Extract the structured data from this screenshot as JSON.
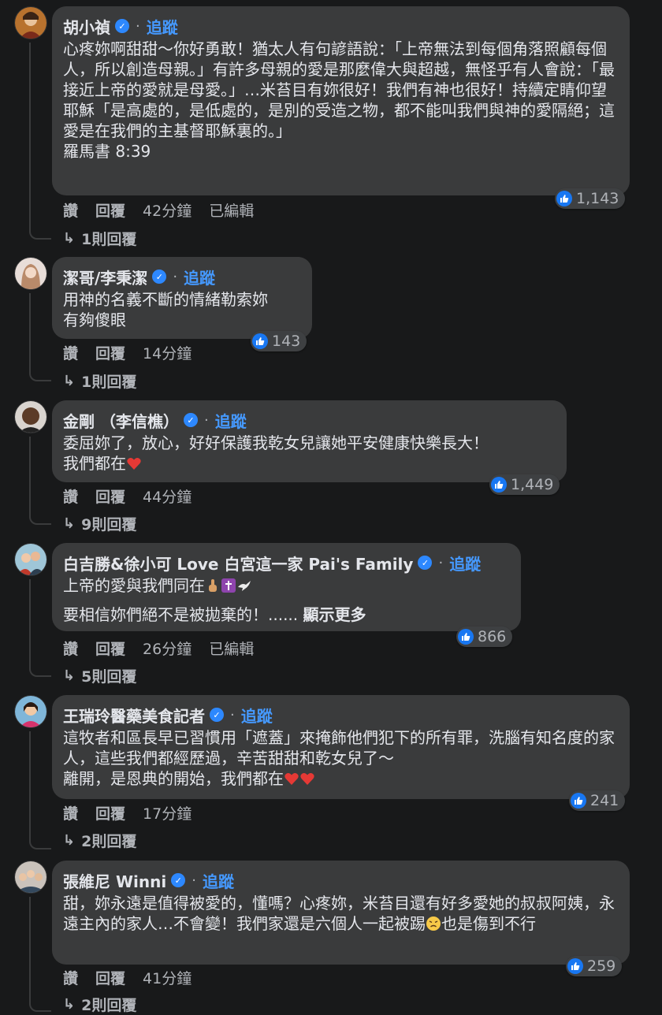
{
  "labels": {
    "follow": "追蹤",
    "like": "讚",
    "reply": "回覆",
    "dot": "·"
  },
  "colors": {
    "background": "#18191a",
    "bubble": "#3a3b3c",
    "accent": "#4599ff",
    "like": "#1877f2"
  },
  "comments": [
    {
      "author": "胡小禎",
      "verified": true,
      "paragraphs": [
        "心疼妳啊甜甜～你好勇敢！猶太人有句諺語說：「上帝無法到每個角落照顧每個人，所以創造母親。」有許多母親的愛是那麼偉大與超越，無怪乎有人會說：「最接近上帝的愛就是母愛。」…米苔目有妳很好！我們有神也很好！持續定睛仰望耶穌「是高處的，是低處的，是別的受造之物，都不能叫我們與神的愛隔絕；這愛是在我們的主基督耶穌裏的。」",
        "羅馬書 8:39"
      ],
      "reactions": "1,143",
      "time": "42分鐘",
      "edited": "已編輯",
      "replies": "1則回覆"
    },
    {
      "author": "潔哥/李秉潔",
      "verified": true,
      "paragraphs": [
        "用神的名義不斷的情緒勒索妳",
        "有夠傻眼"
      ],
      "reactions": "143",
      "time": "14分鐘",
      "replies": "1則回覆"
    },
    {
      "author": "金剛 （李信樵）",
      "verified": true,
      "paragraphs": [
        "委屈妳了，放心，好好保護我乾女兒讓她平安健康快樂長大！",
        "我們都在"
      ],
      "heart_emojis": 1,
      "reactions": "1,449",
      "time": "44分鐘",
      "replies": "9則回覆"
    },
    {
      "author": "白吉勝&徐小可 Love 白宮這一家 Pai's Family",
      "verified": true,
      "paragraphs": [
        "上帝的愛與我們同在",
        "要相信妳們絕不是被拋棄的！......"
      ],
      "emojis": [
        "pointing-up-emoji",
        "latin-cross-emoji",
        "dove-emoji"
      ],
      "see_more": "顯示更多",
      "reactions": "866",
      "time": "26分鐘",
      "edited": "已編輯",
      "replies": "5則回覆"
    },
    {
      "author": "王瑞玲醫藥美食記者",
      "verified": true,
      "paragraphs": [
        "這牧者和區長早已習慣用「遮蓋」來掩飾他們犯下的所有罪，洗腦有知名度的家人，這些我們都經歷過，辛苦甜甜和乾女兒了～",
        "離開，是恩典的開始，我們都在"
      ],
      "heart_emojis": 2,
      "reactions": "241",
      "time": "17分鐘",
      "replies": "2則回覆"
    },
    {
      "author": "張維尼 Winni",
      "verified": true,
      "paragraphs": [
        "甜，妳永遠是值得被愛的，懂嗎？心疼妳，米苔目還有好多愛她的叔叔阿姨，永遠主內的家人…不會變！我們家還是六個人一起被踢",
        "也是傷到不行"
      ],
      "emojis": [
        "persevering-face-emoji"
      ],
      "reactions": "259",
      "time": "41分鐘",
      "replies": "2則回覆"
    }
  ]
}
